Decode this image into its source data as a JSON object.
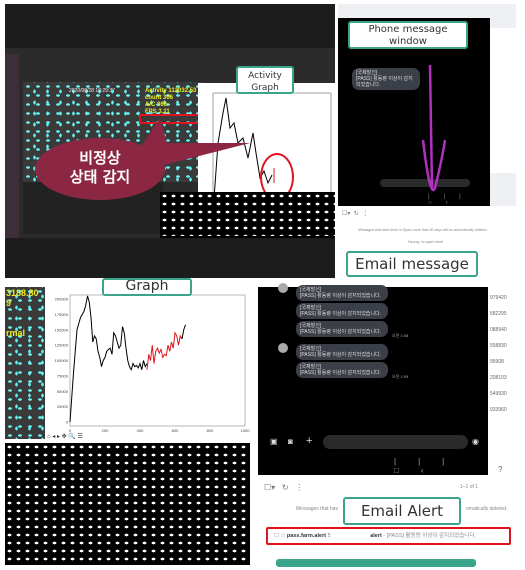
{
  "top": {
    "video_overlay": {
      "activity": "Activity 112032.53",
      "count": "count 306",
      "ac": "A/C 366",
      "fps": "FPS 3.11",
      "timestamp": "2020/08/28 10:29:37"
    },
    "callout": {
      "line1": "비정상",
      "line2": "상태 감지"
    },
    "activity_graph_label": {
      "line1": "Activity",
      "line2": "Graph"
    },
    "phone_label": {
      "line1": "Phone message",
      "line2": "window"
    },
    "phone_message": {
      "sender": "[국제발신]",
      "text": "[PASS] 활동량 이상이 감지되었습니다."
    },
    "email_notice": "Messages that have been in Spam more than 30 days will be automatically deleted.",
    "email_empty": "Hooray, no spam here!",
    "email_label": "Email message"
  },
  "bottom": {
    "video_overlay": {
      "value": "3188.80",
      "line2": "9",
      "status": "rmal"
    },
    "graph_label": "Graph",
    "messages": [
      {
        "sender": "[국제발신]",
        "text": "[PASS] 활동량 이상이 감지되었습니다.",
        "time": ""
      },
      {
        "sender": "[국제발신]",
        "text": "[PASS] 활동량 이상이 감지되었습니다.",
        "time": ""
      },
      {
        "sender": "[국제발신]",
        "text": "[PASS] 활동량 이상이 감지되었습니다.",
        "time": "오전 1:08"
      },
      {
        "sender": "[국제발신]",
        "text": "[PASS] 활동량 이상이 감지되었습니다.",
        "time": ""
      },
      {
        "sender": "[국제발신]",
        "text": "[PASS] 활동량 이상이 감지되었습니다.",
        "time": "오전 1:09"
      }
    ],
    "side_numbers": [
      "979420",
      "582295",
      "088940",
      "558830",
      "95908",
      "208103",
      "549930",
      "933960"
    ],
    "pagination": "1–1 of 1",
    "email_notice_left": "Messages that hav",
    "email_notice_right": "omatically deleted.",
    "email_label": "Email Alert",
    "email_row": {
      "sender": "pass.farm.alert",
      "count": "5",
      "subject": "alert",
      "snippet": "- [PASS] 활동량 이상이 감지되었습니다."
    }
  },
  "colors": {
    "label_border": "#3aa58a",
    "callout": "#8b2742",
    "highlight": "#e0141e",
    "arrow": "#b030c0",
    "series_normal": "#000000",
    "series_abnormal": "#e0141e"
  },
  "chart_data": {
    "type": "line",
    "xlim": [
      0,
      1000
    ],
    "ylim": [
      0,
      200000
    ],
    "xticks": [
      0,
      200,
      400,
      600,
      800,
      1000
    ],
    "yticks": [
      0,
      25000,
      50000,
      75000,
      100000,
      125000,
      150000,
      175000,
      200000
    ],
    "series": [
      {
        "color": "#000000",
        "x": [
          0,
          20,
          40,
          50,
          60,
          70,
          80,
          90,
          100,
          110,
          120,
          130,
          140,
          150,
          160,
          170,
          180,
          190,
          200,
          210,
          220,
          230,
          240,
          250,
          260,
          270,
          280,
          290,
          300,
          310,
          320,
          330,
          340,
          350,
          360,
          370,
          380,
          390,
          400,
          410,
          420,
          430,
          440
        ],
        "y": [
          0,
          80000,
          150000,
          160000,
          170000,
          175000,
          180000,
          190000,
          205000,
          195000,
          170000,
          130000,
          140000,
          135000,
          115000,
          105000,
          90000,
          100000,
          105000,
          115000,
          118000,
          120000,
          110000,
          145000,
          140000,
          130000,
          120000,
          125000,
          155000,
          145000,
          120000,
          100000,
          90000,
          85000,
          95000,
          90000,
          92000,
          88000,
          95000,
          85000,
          100000,
          90000,
          95000
        ]
      },
      {
        "color": "#e0141e",
        "x": [
          440,
          450,
          460,
          470,
          480,
          490,
          500,
          510,
          520,
          530,
          540,
          550,
          560,
          570,
          580,
          590,
          600,
          610,
          620,
          630,
          640
        ],
        "y": [
          85000,
          110000,
          100000,
          125000,
          95000,
          115000,
          120000,
          112000,
          118000,
          105000,
          110000,
          108000,
          125000,
          115000,
          130000,
          120000,
          145000,
          140000,
          125000,
          140000,
          135000
        ]
      },
      {
        "color": "#000000",
        "x": [
          640,
          650,
          660
        ],
        "y": [
          135000,
          150000,
          158000
        ]
      }
    ]
  }
}
